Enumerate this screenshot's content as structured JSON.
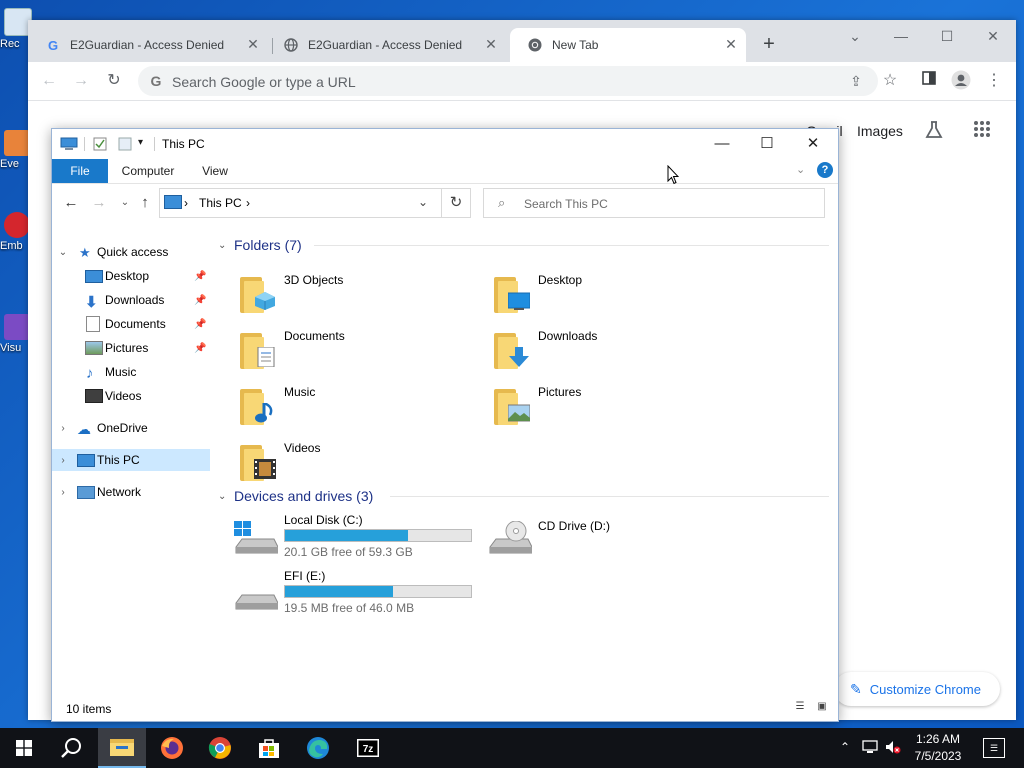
{
  "desktop": {
    "icons": [
      {
        "name": "recycle-bin",
        "label": "Rec"
      },
      {
        "name": "everything",
        "label": "Eve"
      },
      {
        "name": "embarcadero",
        "label": "Emb"
      },
      {
        "name": "visual-studio",
        "label": "Visu"
      }
    ]
  },
  "chrome": {
    "tabs": [
      {
        "title": "E2Guardian - Access Denied",
        "icon": "google-g-icon"
      },
      {
        "title": "E2Guardian - Access Denied",
        "icon": "globe-icon"
      },
      {
        "title": "New Tab",
        "icon": "chrome-icon"
      }
    ],
    "omnibox_placeholder": "Search Google or type a URL",
    "ntp_links": {
      "gmail": "Gmail",
      "images": "Images"
    },
    "customize_label": "Customize Chrome"
  },
  "explorer": {
    "title": "This PC",
    "ribbon_tabs": {
      "file": "File",
      "computer": "Computer",
      "view": "View"
    },
    "address": {
      "crumb": "This PC"
    },
    "search_placeholder": "Search This PC",
    "nav": {
      "quick_access": "Quick access",
      "qa_items": [
        {
          "label": "Desktop",
          "pinned": true
        },
        {
          "label": "Downloads",
          "pinned": true
        },
        {
          "label": "Documents",
          "pinned": true
        },
        {
          "label": "Pictures",
          "pinned": true
        },
        {
          "label": "Music",
          "pinned": false
        },
        {
          "label": "Videos",
          "pinned": false
        }
      ],
      "onedrive": "OneDrive",
      "this_pc": "This PC",
      "network": "Network"
    },
    "folders_header": "Folders (7)",
    "folders": [
      {
        "label": "3D Objects"
      },
      {
        "label": "Desktop"
      },
      {
        "label": "Documents"
      },
      {
        "label": "Downloads"
      },
      {
        "label": "Music"
      },
      {
        "label": "Pictures"
      },
      {
        "label": "Videos"
      }
    ],
    "drives_header": "Devices and drives (3)",
    "drives": [
      {
        "label": "Local Disk (C:)",
        "free_text": "20.1 GB free of 59.3 GB",
        "used_fraction": 0.66
      },
      {
        "label": "CD Drive (D:)"
      },
      {
        "label": "EFI (E:)",
        "free_text": "19.5 MB free of 46.0 MB",
        "used_fraction": 0.58
      }
    ],
    "status_count": "10 items"
  },
  "taskbar": {
    "clock_time": "1:26 AM",
    "clock_date": "7/5/2023"
  },
  "colors": {
    "accent": "#1979ca",
    "drive_bar": "#26a0da",
    "folder": "#f8d775",
    "chrome_link": "#1a73e8"
  }
}
